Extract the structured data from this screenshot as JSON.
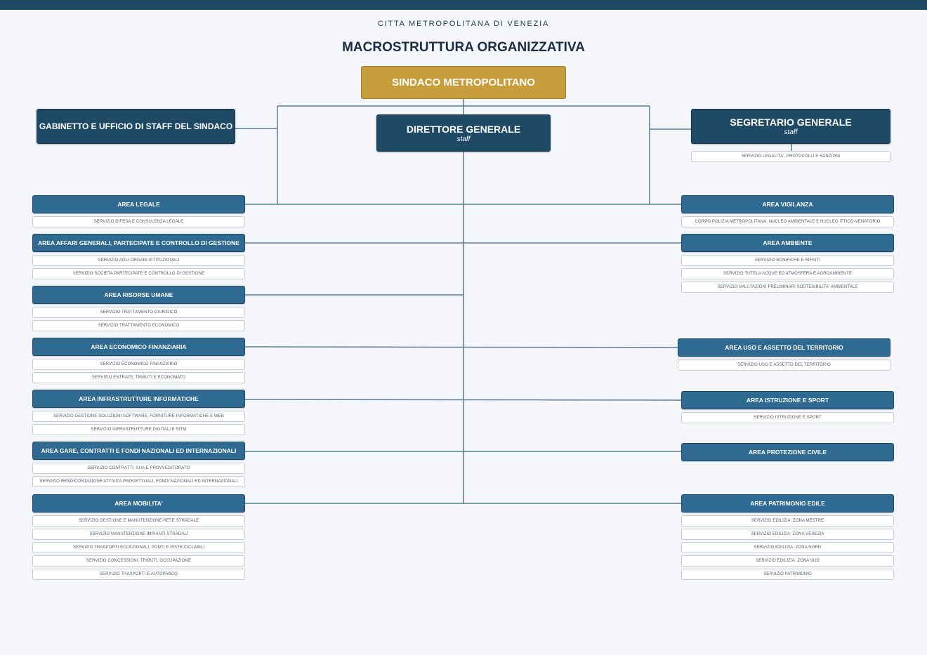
{
  "header": {
    "subtitle": "CITTA METROPOLITANA DI VENEZIA",
    "title": "MACROSTRUTTURA ORGANIZZATIVA"
  },
  "top": {
    "mayor": "SINDACO METROPOLITANO",
    "cabinet": "GABINETTO E UFFICIO DI STAFF DEL SINDACO",
    "director": {
      "title": "DIRETTORE GENERALE",
      "sub": "staff"
    },
    "secretary": {
      "title": "SEGRETARIO GENERALE",
      "sub": "staff",
      "service": "SERVIZIO LEGALITA', PROTOCOLLI E SANZIONI"
    }
  },
  "left_areas": [
    {
      "name": "AREA LEGALE",
      "services": [
        "SERVIZIO DIFESA E CONSULENZA LEGALE"
      ]
    },
    {
      "name": "AREA AFFARI GENERALI, PARTECIPATE E CONTROLLO DI GESTIONE",
      "services": [
        "SERVIZIO AGLI ORGANI ISTITUZIONALI",
        "SERVIZIO SOCIETA PARTECIPATE E CONTROLLO DI GESTIONE"
      ]
    },
    {
      "name": "AREA RISORSE UMANE",
      "services": [
        "SERVIZIO TRATTAMENTO GIURIDICO",
        "SERVIZIO TRATTAMENTO ECONOMICO"
      ]
    },
    {
      "name": "AREA ECONOMICO FINANZIARIA",
      "services": [
        "SERVIZIO ECONOMICO FINANZIARIO",
        "SERVIZIO ENTRATE, TRIBUTI E ECONOMATO"
      ]
    },
    {
      "name": "AREA INFRASTRUTTURE INFORMATICHE",
      "services": [
        "SERVIZIO GESTIONE SOLUZIONI SOFTWARE, FORNITURE INFORMATICHE E WEB",
        "SERVIZIO INFRASTRUTTURE DIGITALI E SITM"
      ]
    },
    {
      "name": "AREA GARE, CONTRATTI E FONDI NAZIONALI ED INTERNAZIONALI",
      "services": [
        "SERVIZIO CONTRATTI, SUA E PROVVEDITORATO",
        "SERVIZIO RENDICONTAZIONE ATTIVITA PROGETTUALI, FONDI NAZIONALI ED INTERNAZIONALI"
      ]
    },
    {
      "name": "AREA MOBILITA'",
      "services": [
        "SERVIZIO GESTIONE E MANUTENZIONE RETE STRADALE",
        "SERVIZIO MANUTENZIONE IMPIANTI STRADALI",
        "SERVIZIO TRASPORTI ECCEZIONALI, PONTI E PISTE CICLABILI",
        "SERVIZIO CONCESSIONI, TRIBUTI, OCCUPAZIONE",
        "SERVIZIO TRASPORTI E AUTOPARCO"
      ]
    }
  ],
  "right_areas": [
    {
      "name": "AREA VIGILANZA",
      "services": [
        "CORPO POLIZIA METROPOLITANA: NUCLEO AMBIENTALE E NUCLEO ITTICO-VENATORIO"
      ]
    },
    {
      "name": "AREA AMBIENTE",
      "services": [
        "SERVIZIO BONIFICHE E RIFIUTI",
        "SERVIZIO TUTELA ACQUE ED ATMOSFERA E AGROAMBIENTE",
        "SERVIZIO VALUTAZIONI PRELIMINARI SOSTENIBILITA' AMBIENTALE"
      ]
    },
    {
      "name": "AREA USO E ASSETTO DEL TERRITORIO",
      "services": [
        "SERVIZIO USO E ASSETTO DEL TERRITORIO"
      ]
    },
    {
      "name": "AREA ISTRUZIONE E SPORT",
      "services": [
        "SERVIZIO ISTRUZIONE E SPORT"
      ]
    },
    {
      "name": "AREA PROTEZIONE CIVILE",
      "services": []
    },
    {
      "name": "AREA PATRIMONIO EDILE",
      "services": [
        "SERVIZIO EDILIZIA: ZONA MESTRE",
        "SERVIZIO EDILIZIA: ZONA VENEZIA",
        "SERVIZIO EDILIZIA: ZONA NORD",
        "SERVIZIO EDILIZIA: ZONA SUD",
        "SERVIZIO PATRIMONIO"
      ]
    }
  ],
  "colors": {
    "mayor": "#c89d3c",
    "dark_box": "#1f4a66",
    "area_box": "#2e6a92",
    "connector": "#5b7d95"
  }
}
